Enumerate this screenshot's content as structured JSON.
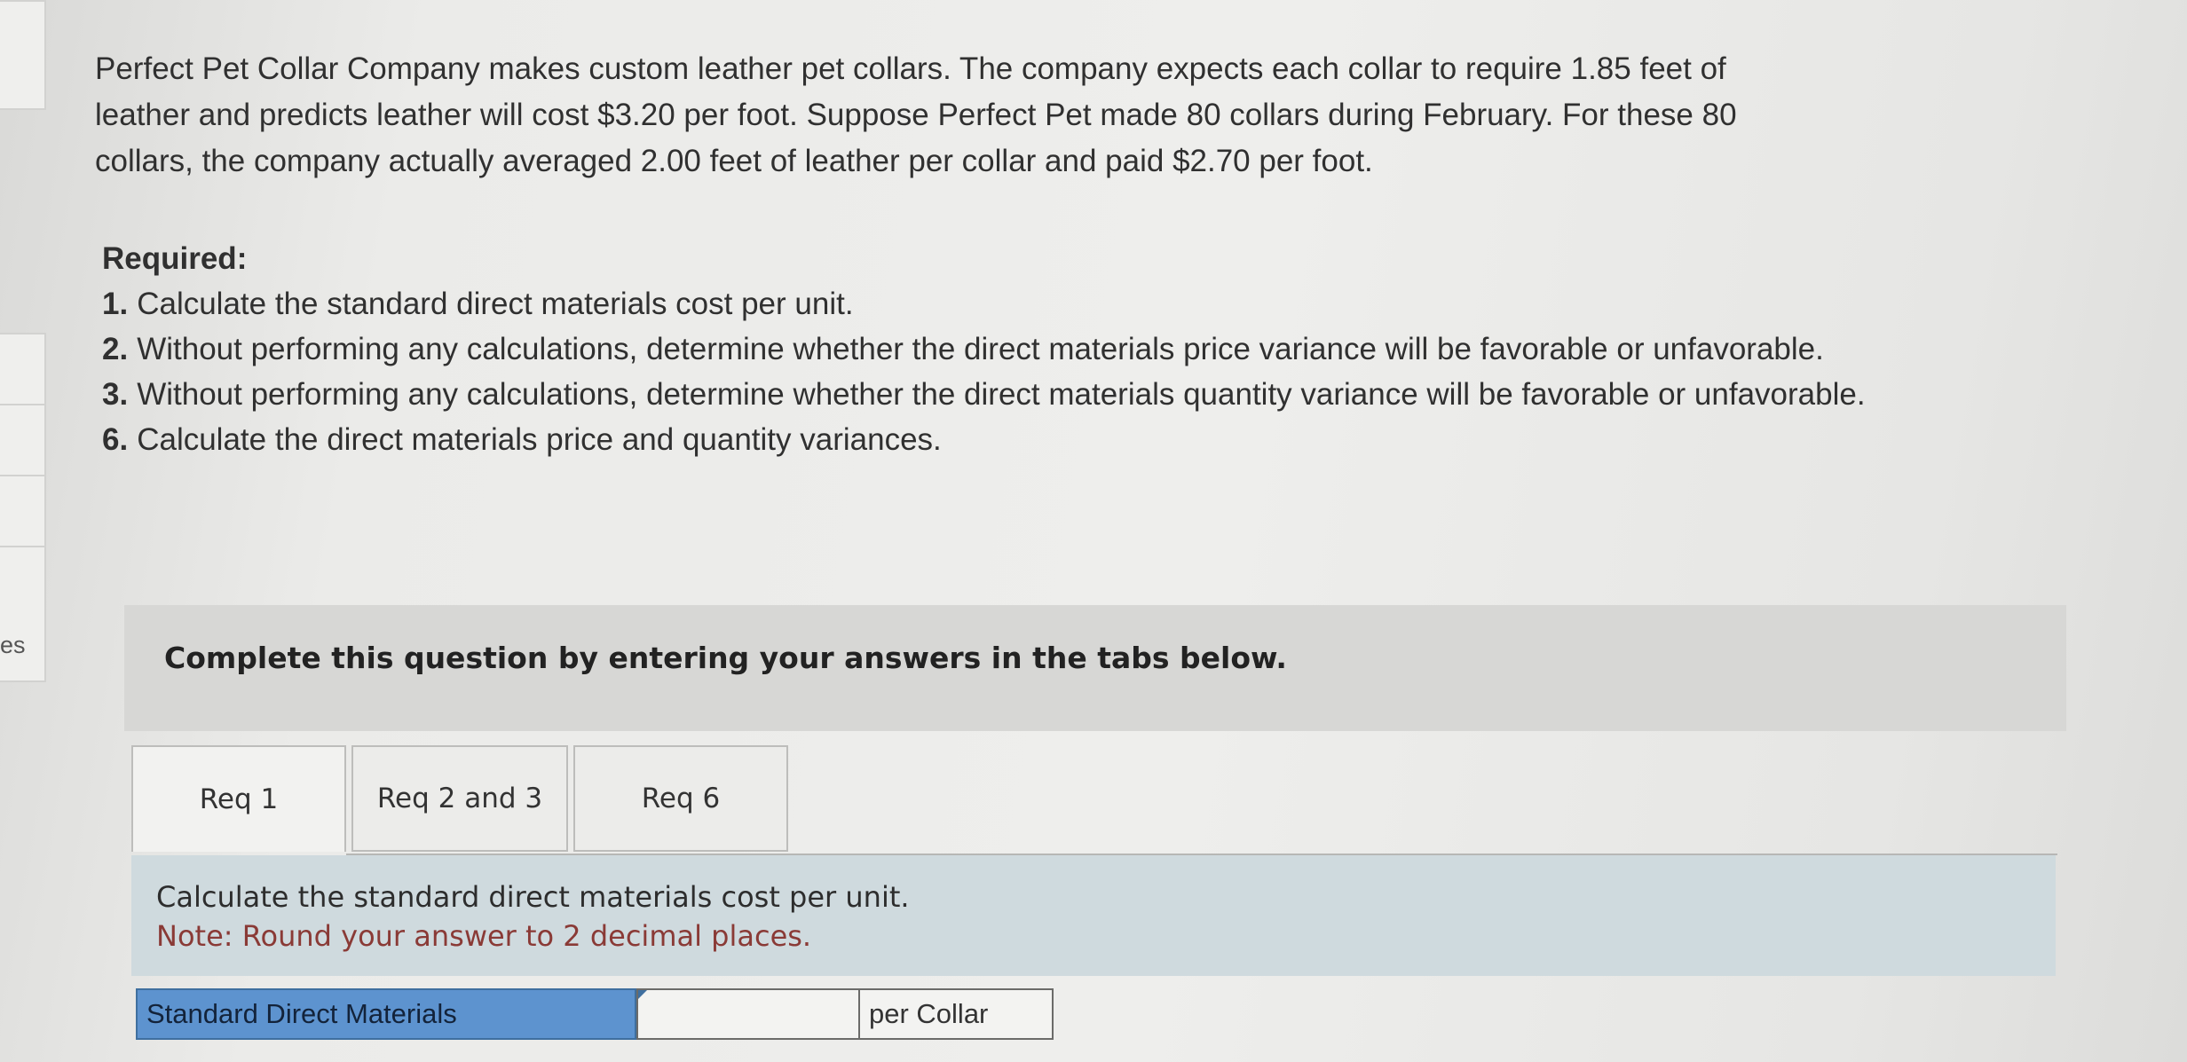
{
  "sidebar": {
    "partial_text": "es"
  },
  "problem": {
    "lines": [
      "Perfect Pet Collar Company makes custom leather pet collars. The company expects each collar to require 1.85 feet of",
      "leather and predicts leather will cost $3.20 per foot. Suppose Perfect Pet made 80 collars during February. For these 80",
      "collars, the company actually averaged 2.00 feet of leather per collar and paid $2.70 per foot."
    ]
  },
  "required": {
    "heading": "Required:",
    "items": [
      {
        "num": "1.",
        "text": "Calculate the standard direct materials cost per unit."
      },
      {
        "num": "2.",
        "text": "Without performing any calculations, determine whether the direct materials price variance will be favorable or unfavorable."
      },
      {
        "num": "3.",
        "text": "Without performing any calculations, determine whether the direct materials quantity variance will be favorable or unfavorable."
      },
      {
        "num": "6.",
        "text": "Calculate the direct materials price and quantity variances."
      }
    ]
  },
  "instruction": "Complete this question by entering your answers in the tabs below.",
  "tabs": [
    {
      "label": "Req 1"
    },
    {
      "label": "Req 2 and 3"
    },
    {
      "label": "Req 6"
    }
  ],
  "panel": {
    "prompt": "Calculate the standard direct materials cost per unit.",
    "note": "Note: Round your answer to 2 decimal places."
  },
  "answer": {
    "label": "Standard Direct Materials",
    "value": "",
    "unit": "per Collar"
  },
  "colors": {
    "label_blue": "#5d93cf",
    "panel_bg": "#cfdade",
    "note_red": "#8a3a36"
  }
}
